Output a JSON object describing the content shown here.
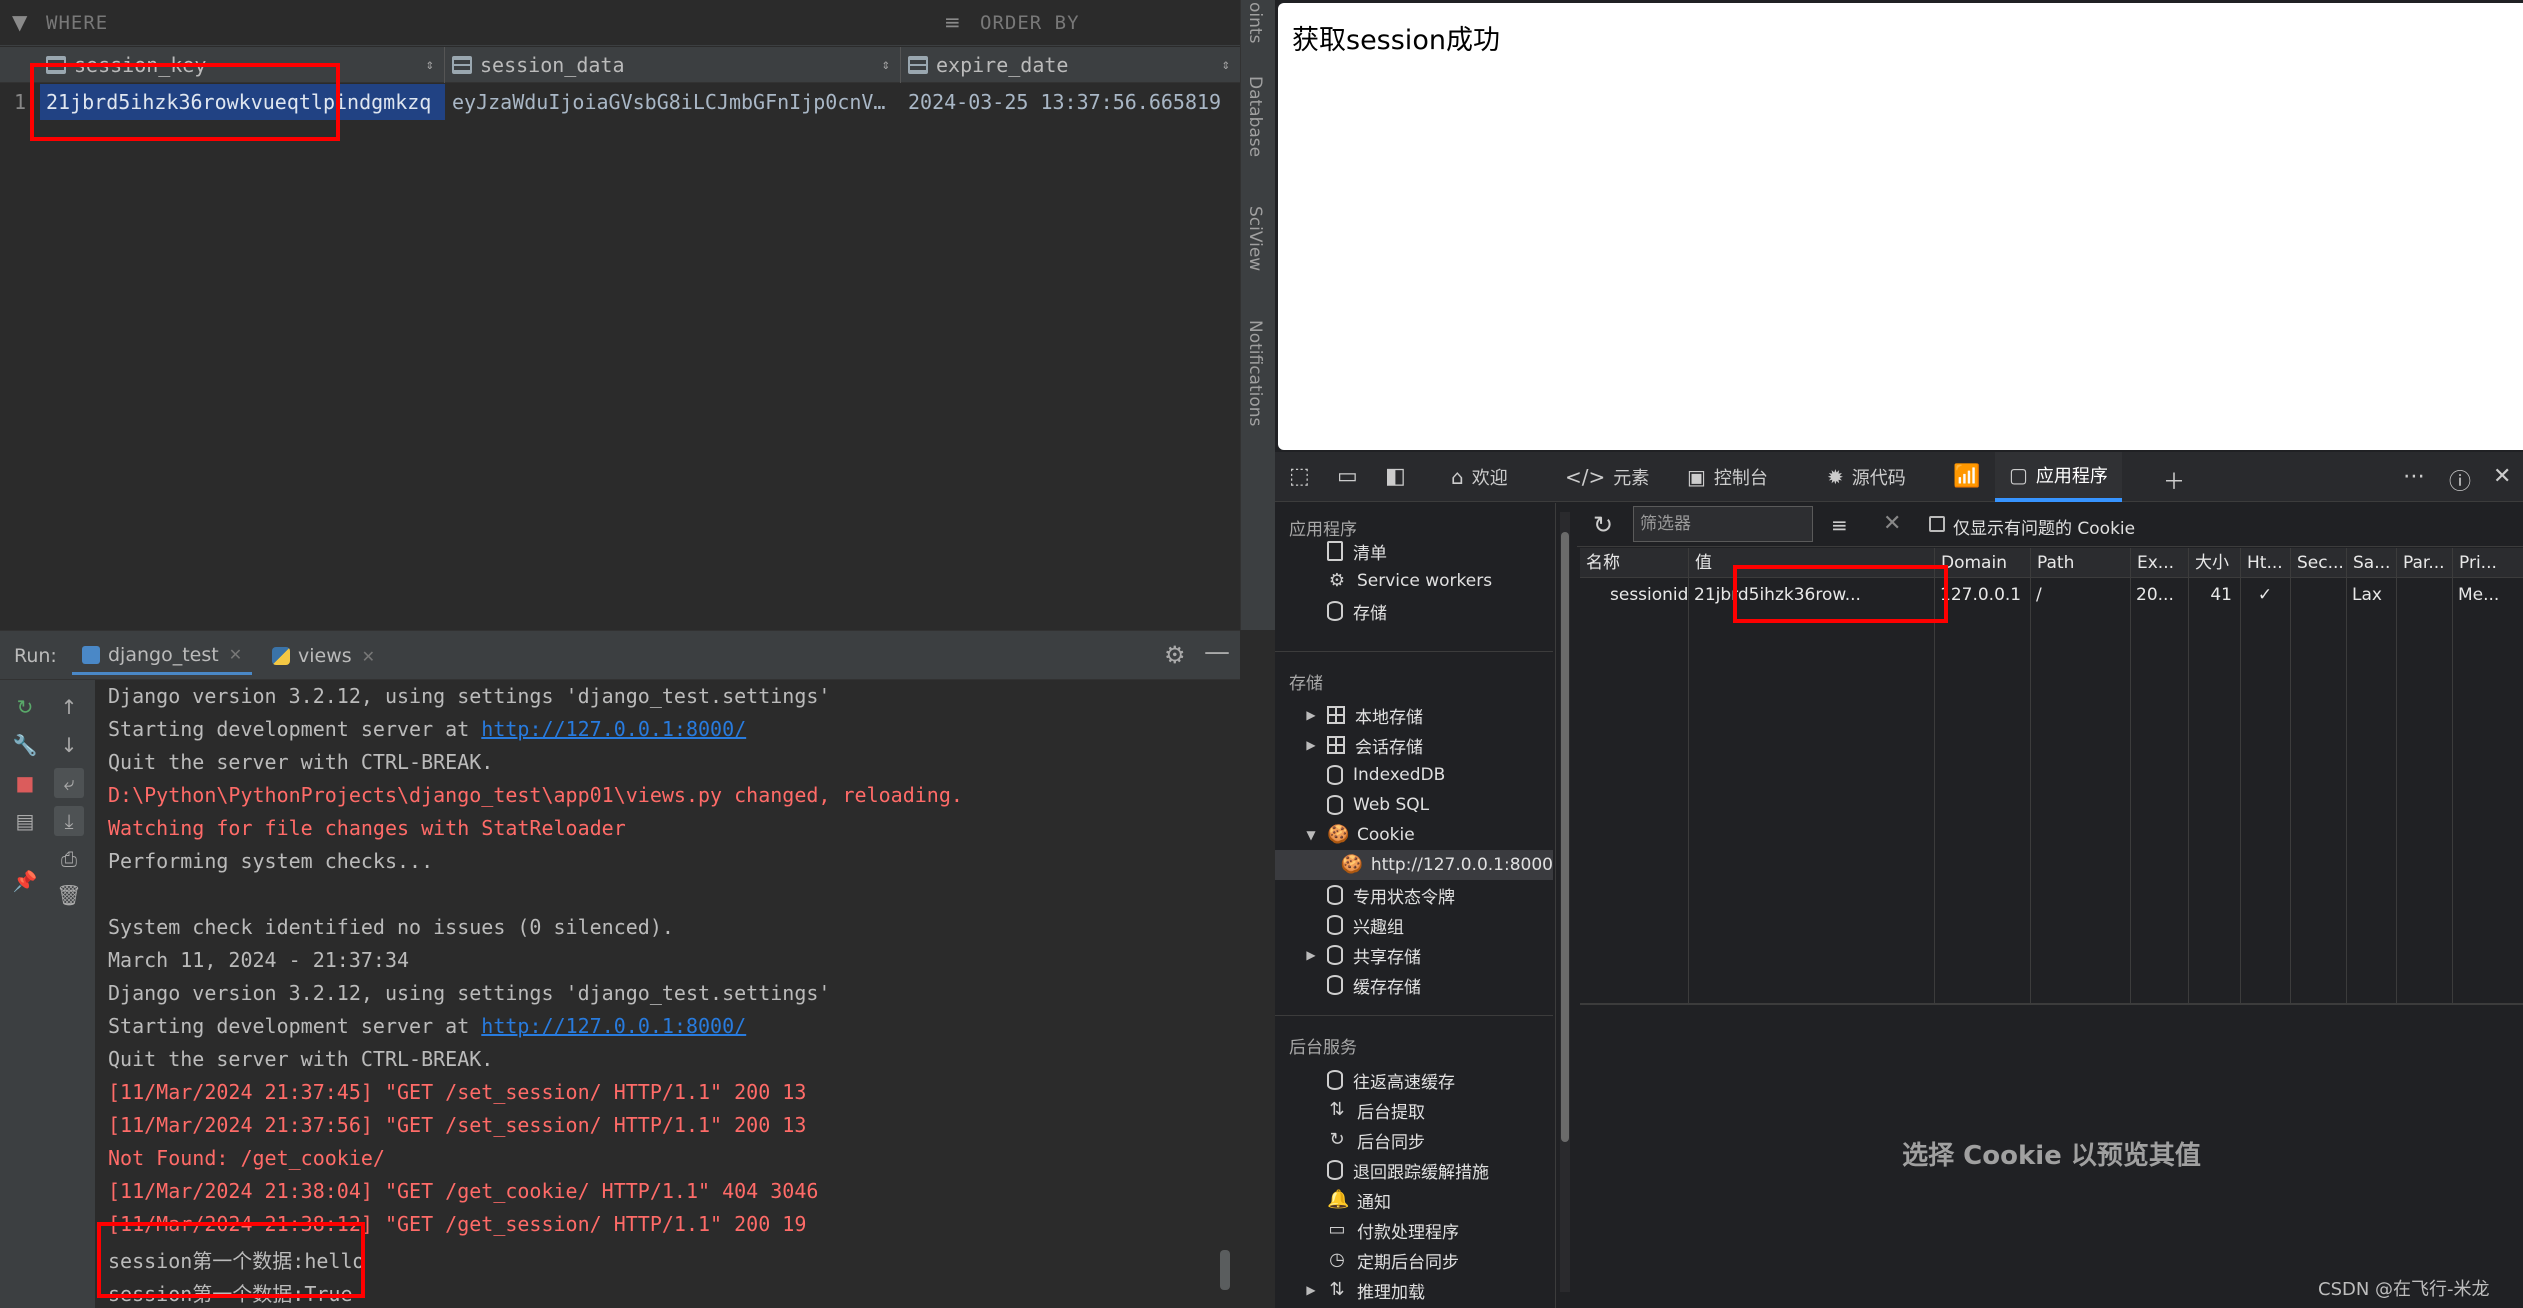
{
  "db": {
    "filter_where": "WHERE",
    "filter_order": "ORDER BY",
    "columns": [
      "session_key",
      "session_data",
      "expire_date"
    ],
    "row": {
      "num": "1",
      "session_key": "21jbrd5ihzk36rowkvueqtlpindgmkzq",
      "session_data": "eyJzaWduIjoiaGVsbG8iLCJmbGFnIjp0cnV…",
      "expire_date": "2024-03-25 13:37:56.665819"
    },
    "side_tabs": [
      "oints",
      "Database",
      "SciView",
      "Notifications"
    ]
  },
  "run": {
    "label": "Run:",
    "tabs": [
      "django_test",
      "views"
    ]
  },
  "console": {
    "lines": [
      {
        "text": "Django version 3.2.12, using settings 'django_test.settings'",
        "kind": "normal"
      },
      {
        "text": "Starting development server at ",
        "link": "http://127.0.0.1:8000/",
        "kind": "normal"
      },
      {
        "text": "Quit the server with CTRL-BREAK.",
        "kind": "normal"
      },
      {
        "text": "D:\\Python\\PythonProjects\\django_test\\app01\\views.py changed, reloading.",
        "kind": "red"
      },
      {
        "text": "Watching for file changes with StatReloader",
        "kind": "red"
      },
      {
        "text": "Performing system checks...",
        "kind": "normal"
      },
      {
        "text": "",
        "kind": "normal"
      },
      {
        "text": "System check identified no issues (0 silenced).",
        "kind": "normal"
      },
      {
        "text": "March 11, 2024 - 21:37:34",
        "kind": "normal"
      },
      {
        "text": "Django version 3.2.12, using settings 'django_test.settings'",
        "kind": "normal"
      },
      {
        "text": "Starting development server at ",
        "link": "http://127.0.0.1:8000/",
        "kind": "normal"
      },
      {
        "text": "Quit the server with CTRL-BREAK.",
        "kind": "normal"
      },
      {
        "text": "[11/Mar/2024 21:37:45] \"GET /set_session/ HTTP/1.1\" 200 13",
        "kind": "red"
      },
      {
        "text": "[11/Mar/2024 21:37:56] \"GET /set_session/ HTTP/1.1\" 200 13",
        "kind": "red"
      },
      {
        "text": "Not Found: /get_cookie/",
        "kind": "red"
      },
      {
        "text": "[11/Mar/2024 21:38:04] \"GET /get_cookie/ HTTP/1.1\" 404 3046",
        "kind": "red"
      },
      {
        "text": "[11/Mar/2024 21:38:12] \"GET /get_session/ HTTP/1.1\" 200 19",
        "kind": "red"
      },
      {
        "text": "session第一个数据:hello",
        "kind": "normal"
      },
      {
        "text": "session第一个数据:True",
        "kind": "normal"
      }
    ]
  },
  "browser": {
    "page_text": "获取session成功",
    "devtools_tabs": [
      "欢迎",
      "元素",
      "控制台",
      "源代码",
      "应用程序"
    ],
    "sidebar": {
      "app_header": "应用程序",
      "app_items": [
        "清单",
        "Service workers",
        "存储"
      ],
      "storage_header": "存储",
      "storage_items": [
        "本地存储",
        "会话存储",
        "IndexedDB",
        "Web SQL",
        "Cookie",
        "http://127.0.0.1:8000",
        "专用状态令牌",
        "兴趣组",
        "共享存储",
        "缓存存储"
      ],
      "bg_header": "后台服务",
      "bg_items": [
        "往返高速缓存",
        "后台提取",
        "后台同步",
        "退回跟踪缓解措施",
        "通知",
        "付款处理程序",
        "定期后台同步",
        "推理加载"
      ]
    },
    "filter_placeholder": "筛选器",
    "only_issues_label": "仅显示有问题的 Cookie",
    "cookie_columns": [
      "名称",
      "值",
      "Domain",
      "Path",
      "Ex...",
      "大小",
      "Ht...",
      "Sec...",
      "Sa...",
      "Par...",
      "Pri..."
    ],
    "cookie_row": [
      "sessionid",
      "21jbrd5ihzk36row...",
      "127.0.0.1",
      "/",
      "20...",
      "41",
      "✓",
      "",
      "Lax",
      "",
      "Me..."
    ],
    "preview_message": "选择 Cookie 以预览其值",
    "watermark": "CSDN @在飞行-米龙"
  },
  "colors": {
    "ide_bg": "#2b2b2b",
    "error_red": "#ff6b68",
    "link_blue": "#287bde",
    "selection_blue": "#214283",
    "highlight_box": "#ff0000",
    "devtools_accent": "#3794ff"
  }
}
